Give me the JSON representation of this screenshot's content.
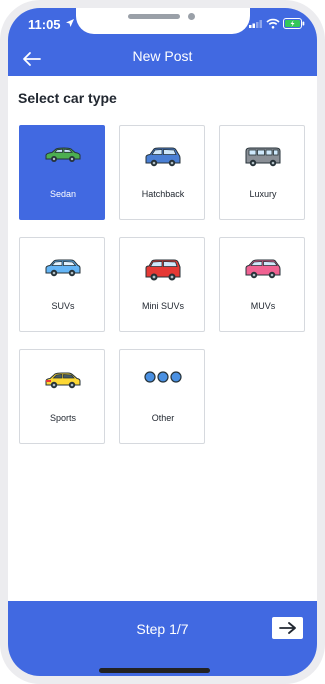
{
  "status_bar": {
    "time": "11:05"
  },
  "header": {
    "title": "New Post"
  },
  "section": {
    "heading": "Select car type"
  },
  "car_types": [
    {
      "label": "Sedan",
      "icon": "sedan-icon",
      "selected": true
    },
    {
      "label": "Hatchback",
      "icon": "hatchback-icon",
      "selected": false
    },
    {
      "label": "Luxury",
      "icon": "luxury-icon",
      "selected": false
    },
    {
      "label": "SUVs",
      "icon": "suv-icon",
      "selected": false
    },
    {
      "label": "Mini SUVs",
      "icon": "mini-suv-icon",
      "selected": false
    },
    {
      "label": "MUVs",
      "icon": "muv-icon",
      "selected": false
    },
    {
      "label": "Sports",
      "icon": "sports-car-icon",
      "selected": false
    },
    {
      "label": "Other",
      "icon": "more-dots-icon",
      "selected": false
    }
  ],
  "footer": {
    "step": "Step 1/7"
  },
  "colors": {
    "accent": "#4169e1",
    "text": "#222831",
    "border": "#d6d9de"
  }
}
